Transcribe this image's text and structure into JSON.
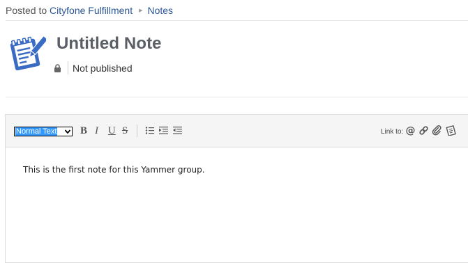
{
  "breadcrumb": {
    "prefix": "Posted to",
    "group": "Cityfone Fulfillment",
    "section": "Notes"
  },
  "note": {
    "title": "Untitled Note",
    "status": "Not published"
  },
  "toolbar": {
    "format_value": "Normal Text",
    "bold": "B",
    "italic": "I",
    "underline": "U",
    "strike": "S",
    "link_to_label": "Link to:"
  },
  "editor": {
    "content": "This is the first note for this Yammer group."
  },
  "colors": {
    "link": "#2b5797",
    "icon_blue": "#3a6cc4",
    "title": "#5a5f66"
  }
}
